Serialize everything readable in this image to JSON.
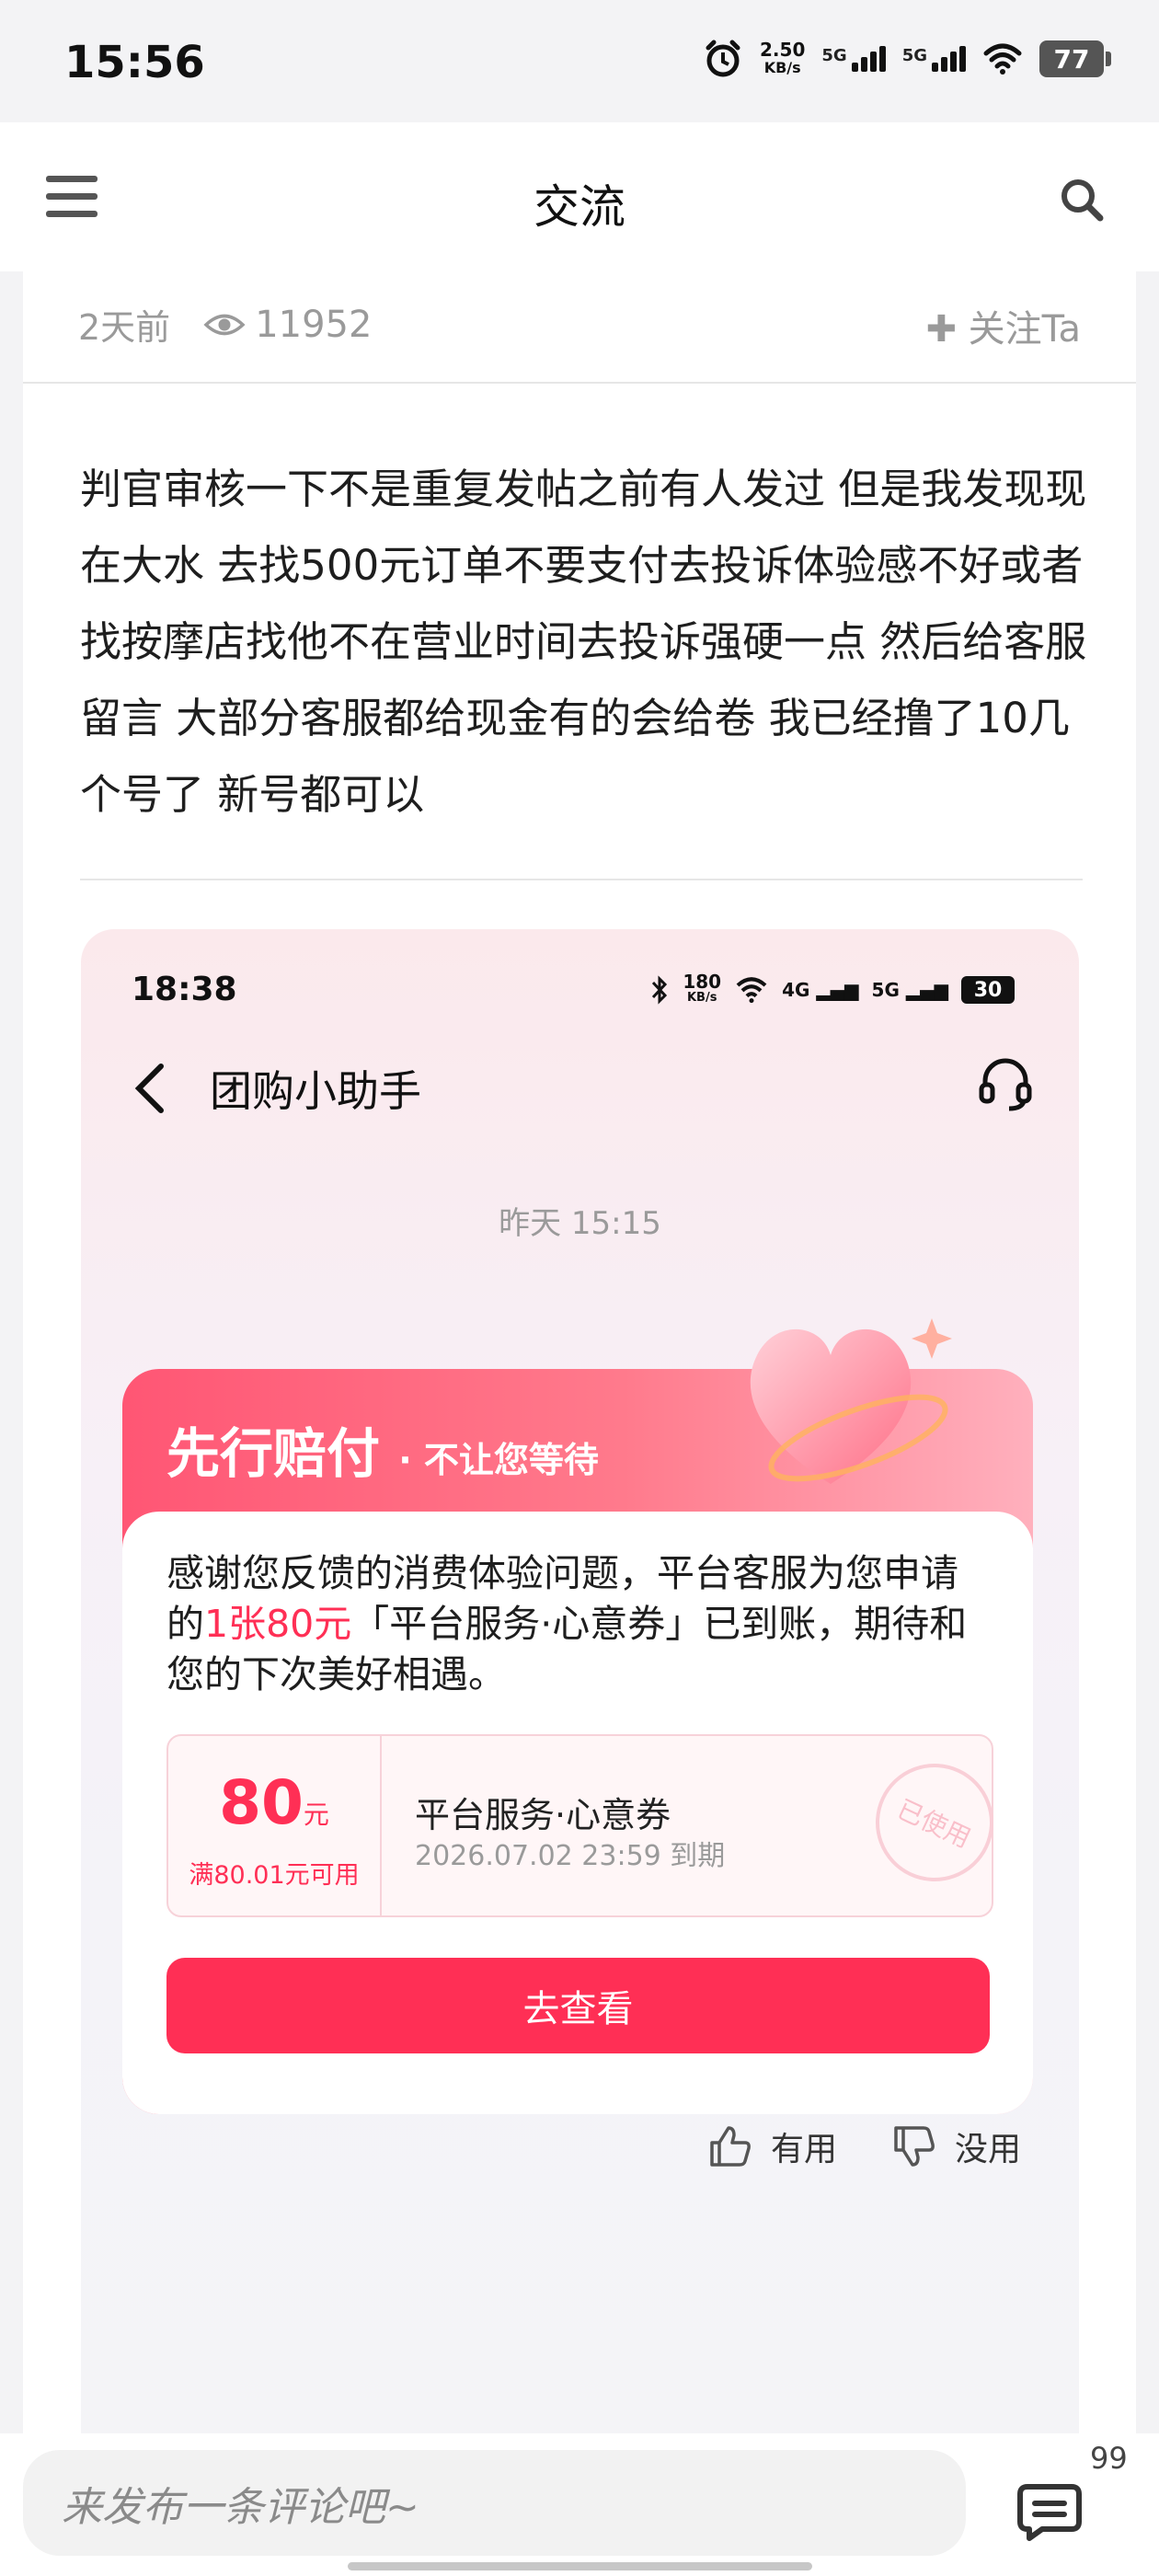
{
  "status_bar": {
    "time": "15:56",
    "speed_value": "2.50",
    "speed_unit": "KB/s",
    "net1": "5G",
    "net2": "5G",
    "battery": "77"
  },
  "header": {
    "title": "交流"
  },
  "post": {
    "time_ago": "2天前",
    "views": "11952",
    "follow_label": "关注Ta",
    "text": "判官审核一下不是重复发帖之前有人发过  但是我发现现在大水  去找500元订单不要支付去投诉体验感不好或者找按摩店找他不在营业时间去投诉强硬一点  然后给客服留言  大部分客服都给现金有的会给卷  我已经撸了10几个号了   新号都可以"
  },
  "screenshot": {
    "time": "18:38",
    "speed_value": "180",
    "speed_unit": "KB/s",
    "net1": "4G",
    "net2": "5G",
    "battery": "30",
    "title": "团购小助手",
    "timestamp": "昨天 15:15",
    "banner_title": "先行赔付",
    "banner_subtitle": "· 不让您等待",
    "message_before": "感谢您反馈的消费体验问题，平台客服为您申请的",
    "message_highlight": "1张80元",
    "message_after": "「平台服务·心意券」已到账，期待和您的下次美好相遇。",
    "coupon": {
      "amount": "80",
      "unit": "元",
      "condition": "满80.01元可用",
      "name": "平台服务·心意券",
      "expiry": "2026.07.02 23:59 到期",
      "stamp": "已使用"
    },
    "button": "去查看",
    "useful": "有用",
    "useless": "没用"
  },
  "bottom_bar": {
    "comment_placeholder": "来发布一条评论吧~",
    "comment_count": "99"
  }
}
